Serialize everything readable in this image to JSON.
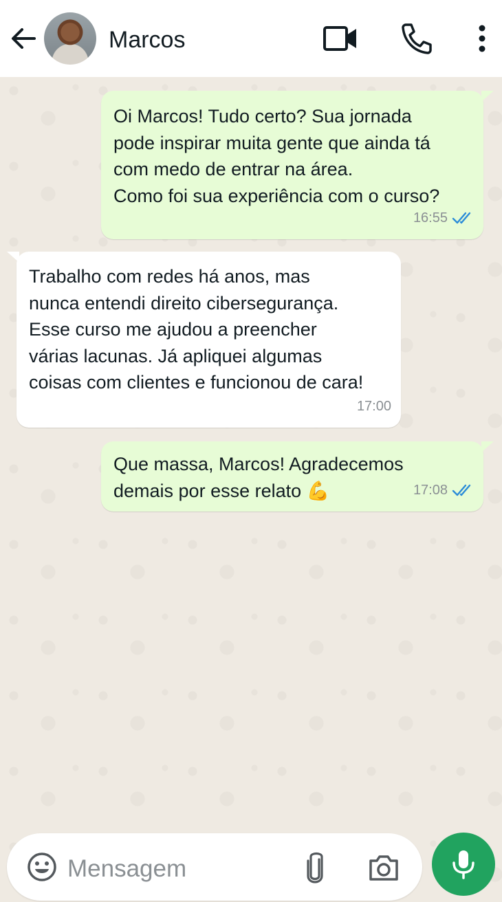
{
  "header": {
    "contact_name": "Marcos",
    "icons": {
      "back": "arrow-left-icon",
      "video": "video-camera-icon",
      "call": "phone-icon",
      "menu": "more-vertical-icon"
    }
  },
  "messages": [
    {
      "direction": "outgoing",
      "text": "Oi Marcos! Tudo certo? Sua jornada\npode inspirar muita gente que ainda tá\ncom medo de entrar na área.\nComo foi sua experiência com o curso?",
      "time": "16:55",
      "status": "read"
    },
    {
      "direction": "incoming",
      "text": "Trabalho com redes há anos, mas\nnunca entendi direito cibersegurança.\nEsse curso me ajudou a preencher\nvárias lacunas. Já apliquei algumas\ncoisas com clientes e funcionou de cara!",
      "time": "17:00"
    },
    {
      "direction": "outgoing",
      "text": "Que massa, Marcos! Agradecemos\ndemais por esse relato 💪",
      "time": "17:08",
      "status": "read"
    }
  ],
  "composer": {
    "placeholder": "Mensagem",
    "icons": {
      "emoji": "emoji-icon",
      "attach": "paperclip-icon",
      "camera": "camera-icon",
      "mic": "microphone-icon"
    }
  },
  "colors": {
    "outgoing_bubble": "#e7fcd6",
    "incoming_bubble": "#ffffff",
    "read_ticks": "#2a8bd8",
    "mic_button": "#21a35f",
    "chat_background": "#efeae2"
  }
}
